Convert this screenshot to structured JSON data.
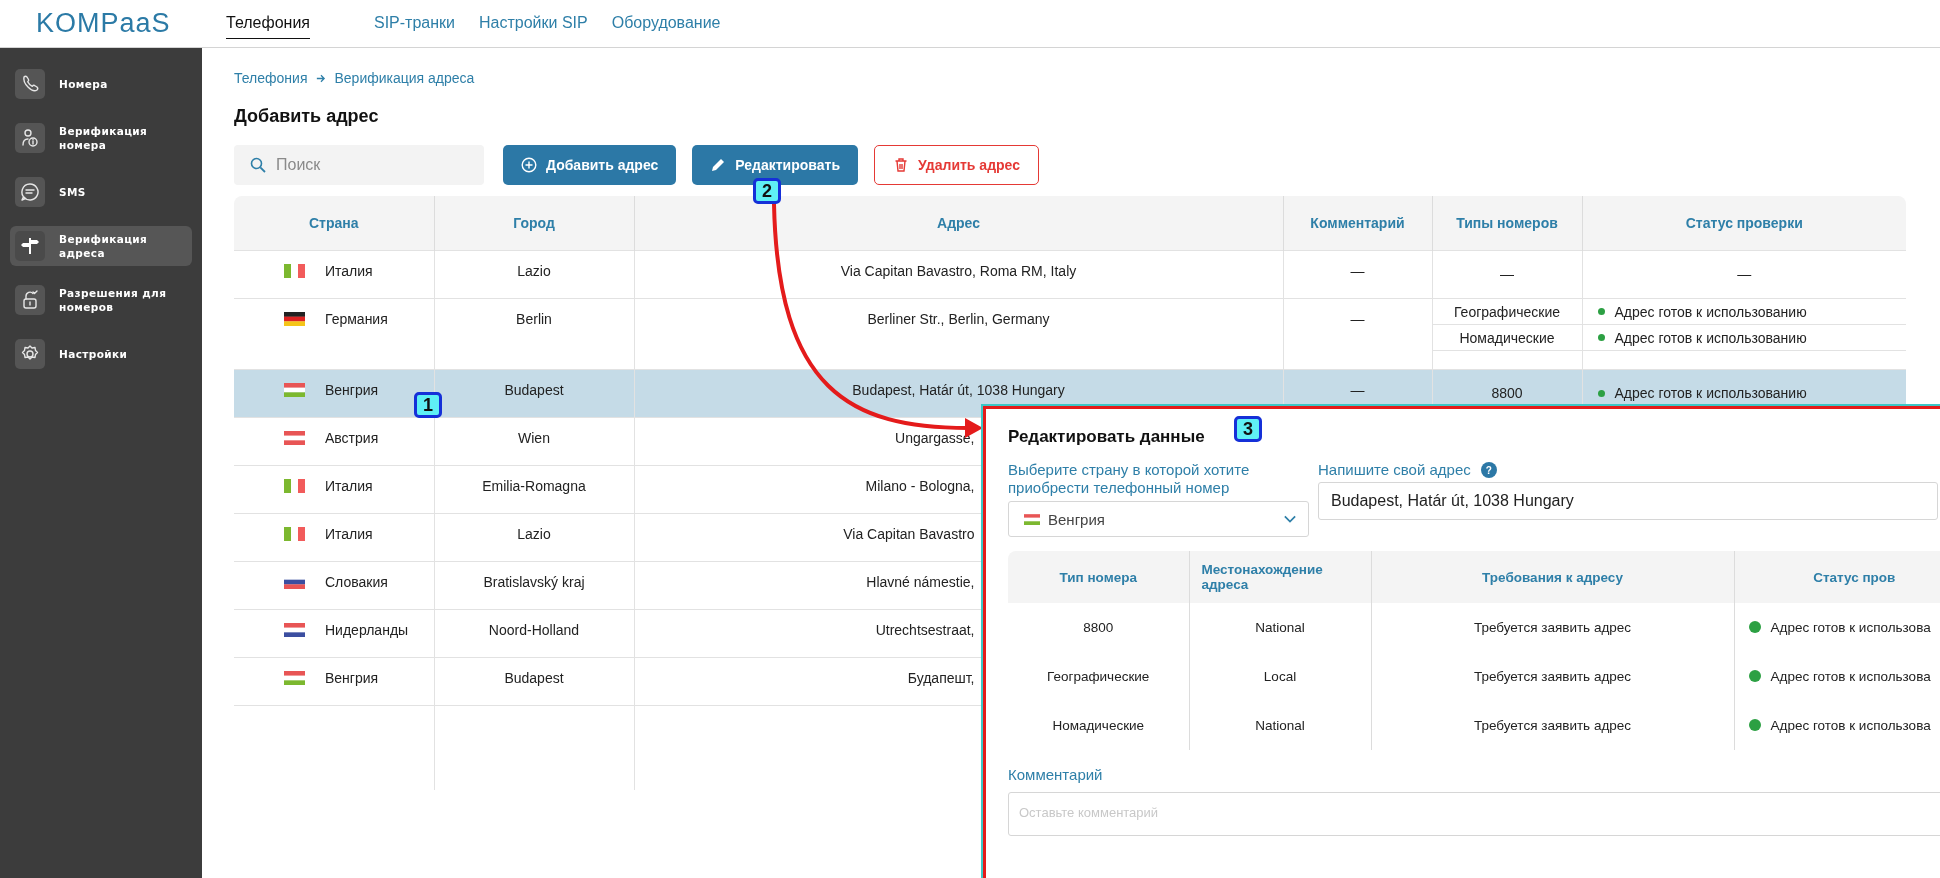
{
  "header": {
    "logo": "KOMPaaS",
    "tabs": [
      {
        "label": "Телефония",
        "selected": true
      },
      {
        "label": "SIP-транки",
        "selected": false
      },
      {
        "label": "Настройки SIP",
        "selected": false
      },
      {
        "label": "Оборудование",
        "selected": false
      }
    ]
  },
  "sidebar": {
    "items": [
      {
        "label": "Номера",
        "selected": false
      },
      {
        "label": "Верификация номера",
        "selected": false
      },
      {
        "label": "SMS",
        "selected": false
      },
      {
        "label": "Верификация адреса",
        "selected": true
      },
      {
        "label": "Разрешения для номеров",
        "selected": false
      },
      {
        "label": "Настройки",
        "selected": false
      }
    ]
  },
  "breadcrumb": [
    "Телефония",
    "Верификация адреса"
  ],
  "page_title": "Добавить адрес",
  "search": {
    "placeholder": "Поиск"
  },
  "buttons": [
    {
      "label": "Добавить адрес",
      "kind": "add"
    },
    {
      "label": "Редактировать",
      "kind": "edit"
    },
    {
      "label": "Удалить адрес",
      "kind": "delete"
    }
  ],
  "table": {
    "columns": [
      "Страна",
      "Город",
      "Адрес",
      "Комментарий",
      "Типы номеров",
      "Статус проверки"
    ],
    "rows": [
      {
        "country": "Италия",
        "kind": "it",
        "city": "Lazio",
        "address": "Via Capitan Bavastro, Roma RM, Italy",
        "comment": "—",
        "selected": false,
        "types": [
          {
            "label": "—",
            "status": "—"
          }
        ]
      },
      {
        "country": "Германия",
        "kind": "de",
        "city": "Berlin",
        "address": "Berliner Str., Berlin, Germany",
        "comment": "—",
        "selected": false,
        "types": [
          {
            "label": "Географические",
            "status": "Адрес готов к использованию",
            "color": "#2ca043"
          },
          {
            "label": "Номадические",
            "status": "Адрес готов к использованию",
            "color": "#2ca043"
          }
        ]
      },
      {
        "country": "Венгрия",
        "kind": "hu",
        "city": "Budapest",
        "address": "Budapest, Határ út, 1038 Hungary",
        "comment": "—",
        "selected": true,
        "types": [
          {
            "label": "8800",
            "status": "Адрес готов к использованию",
            "color": "#2ca043"
          }
        ]
      },
      {
        "country": "Австрия",
        "kind": "at",
        "city": "Wien",
        "address": "Ungargasse,",
        "selected": false
      },
      {
        "country": "Италия",
        "kind": "it",
        "city": "Emilia-Romagna",
        "address": "Milano - Bologna,",
        "selected": false
      },
      {
        "country": "Италия",
        "kind": "it",
        "city": "Lazio",
        "address": "Via Capitan Bavastro",
        "selected": false
      },
      {
        "country": "Словакия",
        "kind": "sk",
        "city": "Bratislavský kraj",
        "address": "Hlavné námestie,",
        "selected": false
      },
      {
        "country": "Нидерланды",
        "kind": "nl",
        "city": "Noord-Holland",
        "address": "Utrechtsestraat,",
        "selected": false
      },
      {
        "country": "Венгрия",
        "kind": "hu",
        "city": "Budapest",
        "address": "Будапешт,",
        "selected": false
      }
    ]
  },
  "dialog": {
    "title": "Редактировать данные",
    "country_label": "Выберите страну в которой хотите приобрести телефонный номер",
    "country": {
      "value": "Венгрия",
      "kind": "hu"
    },
    "address_label": "Напишите свой адрес",
    "address_help": "?",
    "address_value": "Budapest, Határ út, 1038 Hungary",
    "table": {
      "columns": [
        "Тип номера",
        "Местонахождение адреса",
        "Требования к адресу",
        "Статус пров"
      ],
      "rows": [
        {
          "type": "8800",
          "location": "National",
          "requirement": "Требуется заявить адрес",
          "status": "Адрес готов к использова",
          "color": "#2ca043"
        },
        {
          "type": "Географические",
          "location": "Local",
          "requirement": "Требуется заявить адрес",
          "status": "Адрес готов к использова",
          "color": "#2ca043"
        },
        {
          "type": "Номадические",
          "location": "National",
          "requirement": "Требуется заявить адрес",
          "status": "Адрес готов к использова",
          "color": "#2ca043"
        }
      ]
    },
    "comment_label": "Комментарий",
    "comment_placeholder": "Оставьте комментарий"
  },
  "annotations": [
    {
      "label": "1"
    },
    {
      "label": "2"
    },
    {
      "label": "3"
    }
  ]
}
